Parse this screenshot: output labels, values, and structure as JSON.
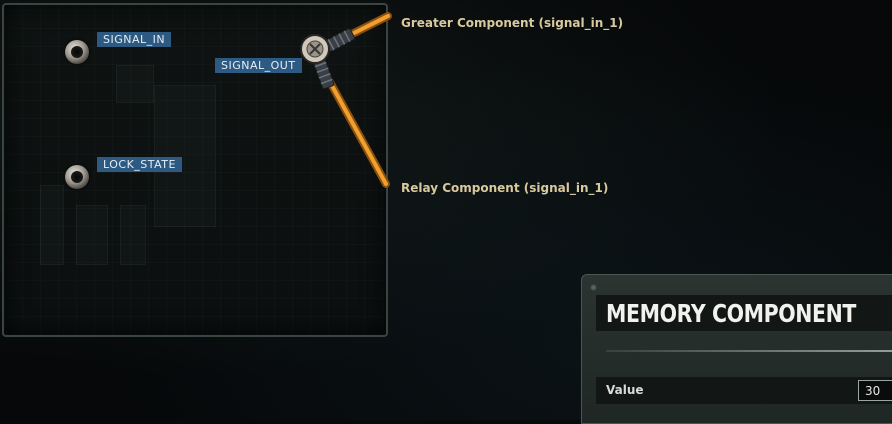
{
  "wiring_panel": {
    "pins": [
      {
        "name": "SIGNAL_IN"
      },
      {
        "name": "LOCK_STATE"
      },
      {
        "name": "SIGNAL_OUT"
      }
    ]
  },
  "connections": [
    {
      "label": "Greater Component (signal_in_1)"
    },
    {
      "label": "Relay Component (signal_in_1)"
    }
  ],
  "colors": {
    "wire": "#e8931c",
    "pin_label_bg": "#2d5a82",
    "connection_label": "#d9c99e"
  },
  "memory_component": {
    "title": "MEMORY COMPONENT",
    "fields": [
      {
        "label": "Value",
        "value": "30"
      }
    ]
  }
}
